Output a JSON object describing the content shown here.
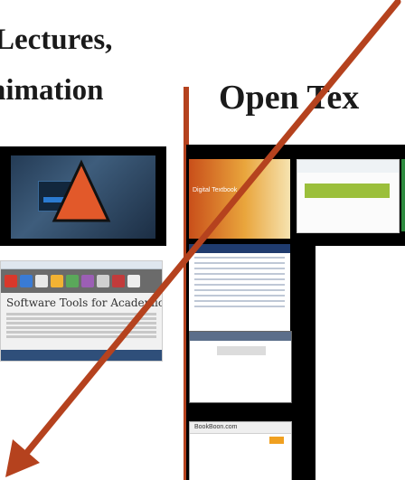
{
  "headings": {
    "lectures": "Lectures,",
    "animation": "nimation",
    "open_texts": "Open Tex"
  },
  "thumbnails": {
    "software_tools_title": "Software Tools for Academics and Researchers",
    "book_banner": "Digital Textbook",
    "bb_label": "BookBoon.com"
  },
  "colors": {
    "arrow": "#b5421e",
    "divider": "#b5421e",
    "play_triangle": "#e2592a"
  },
  "icons": [
    "play-triangle-icon",
    "arrow-icon"
  ]
}
